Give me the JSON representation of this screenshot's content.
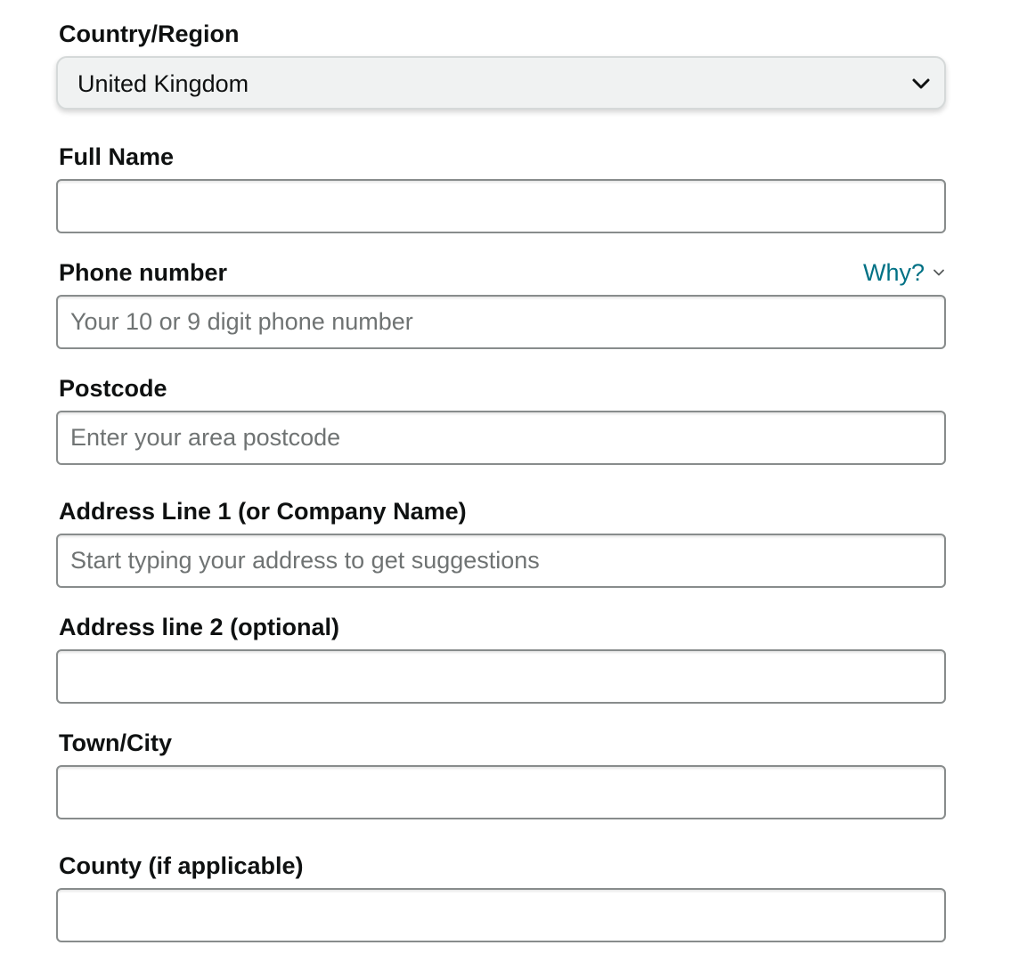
{
  "form": {
    "country": {
      "label": "Country/Region",
      "selected": "United Kingdom"
    },
    "full_name": {
      "label": "Full Name",
      "value": "",
      "placeholder": ""
    },
    "phone": {
      "label": "Phone number",
      "why_link": "Why?",
      "value": "",
      "placeholder": "Your 10 or 9 digit phone number"
    },
    "postcode": {
      "label": "Postcode",
      "value": "",
      "placeholder": "Enter your area postcode"
    },
    "address1": {
      "label": "Address Line 1 (or Company Name)",
      "value": "",
      "placeholder": "Start typing your address to get suggestions"
    },
    "address2": {
      "label": "Address line 2 (optional)",
      "value": "",
      "placeholder": ""
    },
    "town": {
      "label": "Town/City",
      "value": "",
      "placeholder": ""
    },
    "county": {
      "label": "County (if applicable)",
      "value": "",
      "placeholder": ""
    }
  },
  "colors": {
    "link": "#007185",
    "text": "#0f1111",
    "input_border": "#888c8c",
    "select_background": "#f0f2f2"
  },
  "icons": {
    "select_chevron": "chevron-down-icon",
    "why_chevron": "chevron-down-icon"
  }
}
